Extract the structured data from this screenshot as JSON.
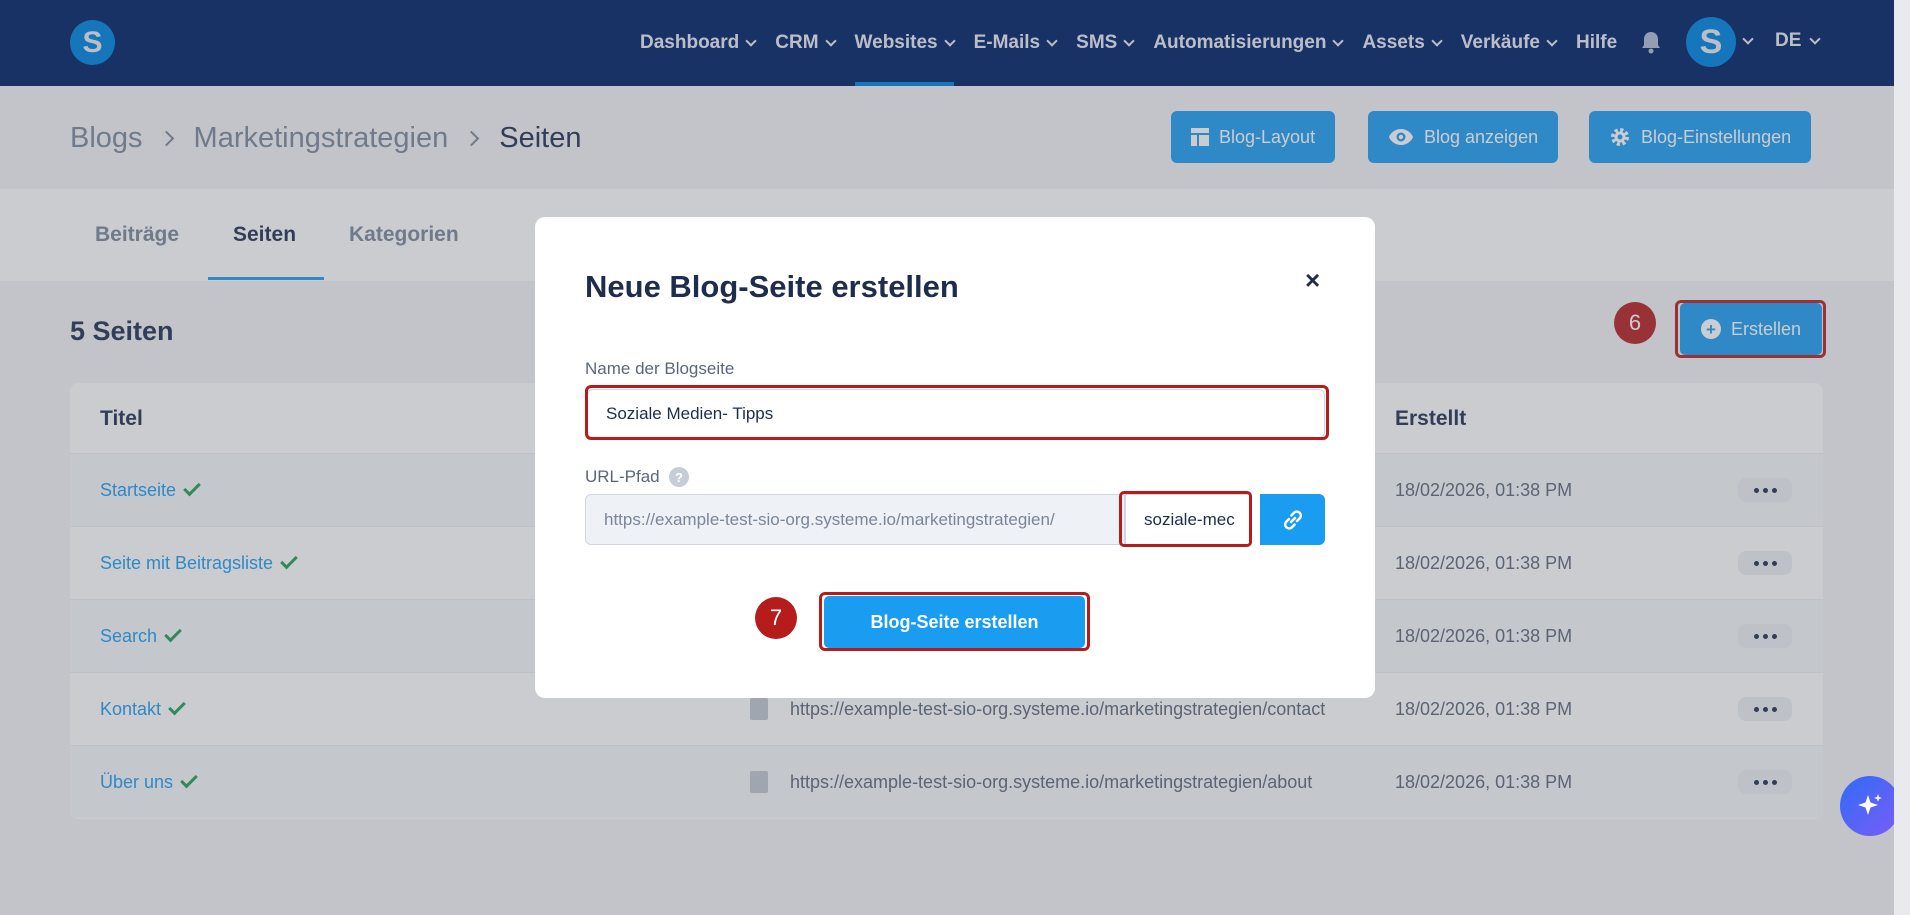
{
  "nav": {
    "logo_letter": "S",
    "items": [
      {
        "label": "Dashboard",
        "dropdown": true
      },
      {
        "label": "CRM",
        "dropdown": true
      },
      {
        "label": "Websites",
        "dropdown": true,
        "active": true
      },
      {
        "label": "E-Mails",
        "dropdown": true
      },
      {
        "label": "SMS",
        "dropdown": true
      },
      {
        "label": "Automatisierungen",
        "dropdown": true
      },
      {
        "label": "Assets",
        "dropdown": true
      },
      {
        "label": "Verkäufe",
        "dropdown": true
      },
      {
        "label": "Hilfe",
        "dropdown": false
      }
    ],
    "avatar_letter": "S",
    "language": "DE"
  },
  "breadcrumb": {
    "items": [
      "Blogs",
      "Marketingstrategien",
      "Seiten"
    ]
  },
  "header_buttons": {
    "layout": "Blog-Layout",
    "view": "Blog anzeigen",
    "settings": "Blog-Einstellungen"
  },
  "tabs": [
    "Beiträge",
    "Seiten",
    "Kategorien"
  ],
  "page": {
    "count_title": "5 Seiten",
    "create_label": "Erstellen",
    "step_create": "6",
    "step_submit": "7"
  },
  "table": {
    "columns": {
      "title": "Titel",
      "created": "Erstellt"
    },
    "rows": [
      {
        "title": "Startseite",
        "url": "",
        "date": "18/02/2026, 01:38 PM"
      },
      {
        "title": "Seite mit Beitragsliste",
        "url": "",
        "date": "18/02/2026, 01:38 PM"
      },
      {
        "title": "Search",
        "url": "",
        "date": "18/02/2026, 01:38 PM"
      },
      {
        "title": "Kontakt",
        "url": "https://example-test-sio-org.systeme.io/marketingstrategien/contact",
        "date": "18/02/2026, 01:38 PM"
      },
      {
        "title": "Über uns",
        "url": "https://example-test-sio-org.systeme.io/marketingstrategien/about",
        "date": "18/02/2026, 01:38 PM"
      }
    ]
  },
  "modal": {
    "title": "Neue Blog-Seite erstellen",
    "close": "×",
    "name_label": "Name der Blogseite",
    "name_value": "Soziale Medien- Tipps",
    "url_label": "URL-Pfad",
    "url_prefix": "https://example-test-sio-org.systeme.io/marketingstrategien/",
    "url_slug": "soziale-mec",
    "submit_label": "Blog-Seite erstellen"
  },
  "colors": {
    "nav_bg": "#1f3d7a",
    "accent": "#1a9cf0",
    "highlight": "#b71c1c",
    "success": "#1f9d55"
  }
}
